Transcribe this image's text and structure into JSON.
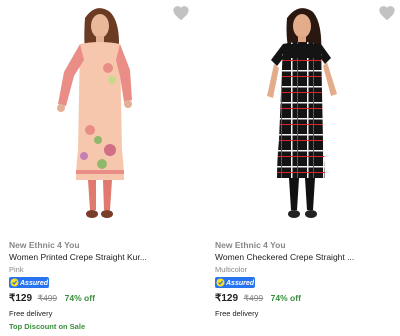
{
  "products": [
    {
      "brand": "New Ethnic 4 You",
      "title": "Women Printed Crepe Straight Kur...",
      "variant": "Pink",
      "badge": "Assured",
      "price": "₹129",
      "mrp": "₹499",
      "discount": "74% off",
      "delivery": "Free delivery",
      "offer": "Top Discount on Sale",
      "image_icon": "pink-printed-kurta-model-image",
      "colors": {
        "kurta": "#f6c7ad",
        "leggings": "#e07a6f",
        "sleeve": "#e98d86"
      }
    },
    {
      "brand": "New Ethnic 4 You",
      "title": "Women Checkered Crepe Straight ...",
      "variant": "Multicolor",
      "badge": "Assured",
      "price": "₹129",
      "mrp": "₹499",
      "discount": "74% off",
      "delivery": "Free delivery",
      "image_icon": "black-checkered-kurta-model-image",
      "colors": {
        "kurta": "#141414",
        "check_red": "#d8262e",
        "check_white": "#f2f2f2"
      }
    }
  ],
  "accent": {
    "assured_blue": "#2874f0",
    "discount_green": "#388e3c",
    "muted_gray": "#878787"
  }
}
